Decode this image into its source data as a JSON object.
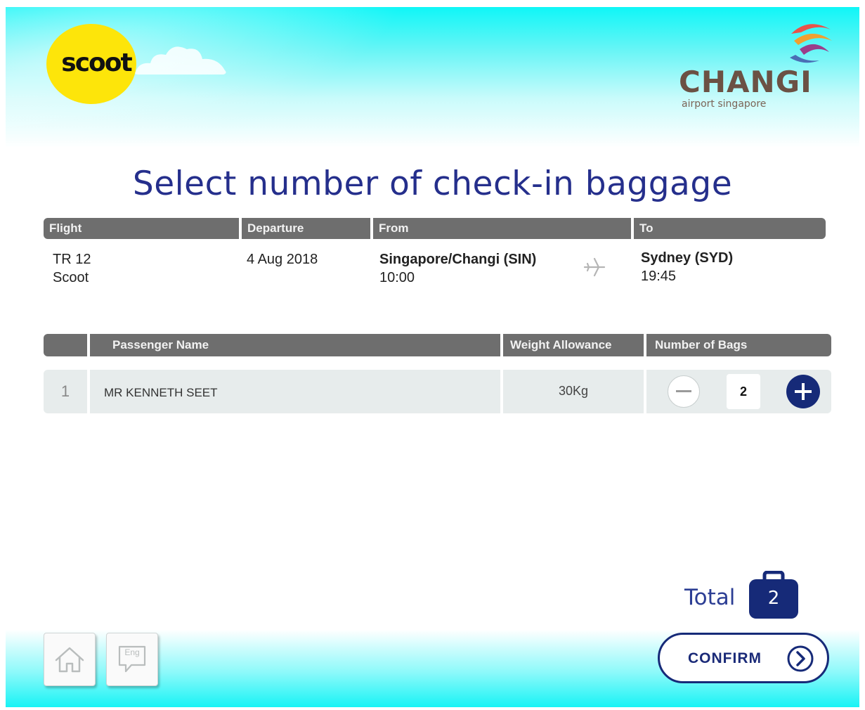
{
  "branding": {
    "airline_logo_text": "scoot",
    "airport_name": "CHANGI",
    "airport_subtitle": "airport singapore"
  },
  "page": {
    "title": "Select number of check-in baggage"
  },
  "flight_table": {
    "headers": {
      "flight": "Flight",
      "departure": "Departure",
      "from": "From",
      "to": "To"
    },
    "flight_number": "TR 12",
    "airline": "Scoot",
    "departure_date": "4 Aug 2018",
    "from_airport": "Singapore/Changi (SIN)",
    "from_time": "10:00",
    "to_airport": "Sydney (SYD)",
    "to_time": "19:45"
  },
  "passenger_table": {
    "headers": {
      "number": "",
      "name": "Passenger Name",
      "weight": "Weight Allowance",
      "bags": "Number of Bags"
    },
    "rows": [
      {
        "number": "1",
        "name": "MR KENNETH SEET",
        "weight": "30Kg",
        "bags": "2"
      }
    ]
  },
  "total": {
    "label": "Total",
    "count": "2"
  },
  "buttons": {
    "confirm": "CONFIRM",
    "language": "Eng"
  },
  "icons": {
    "home": "home-icon",
    "language": "language-icon",
    "plane": "plane-icon",
    "minus": "minus-icon",
    "plus": "plus-icon",
    "luggage": "luggage-icon",
    "arrow": "chevron-right-icon"
  },
  "colors": {
    "title_blue": "#252f8c",
    "navy": "#162a78",
    "header_gray": "#6e6e6e",
    "row_gray": "#e7ecec",
    "scoot_yellow": "#fde50a",
    "cyan": "#0ff6f7",
    "changi_brown": "#6b5144"
  }
}
